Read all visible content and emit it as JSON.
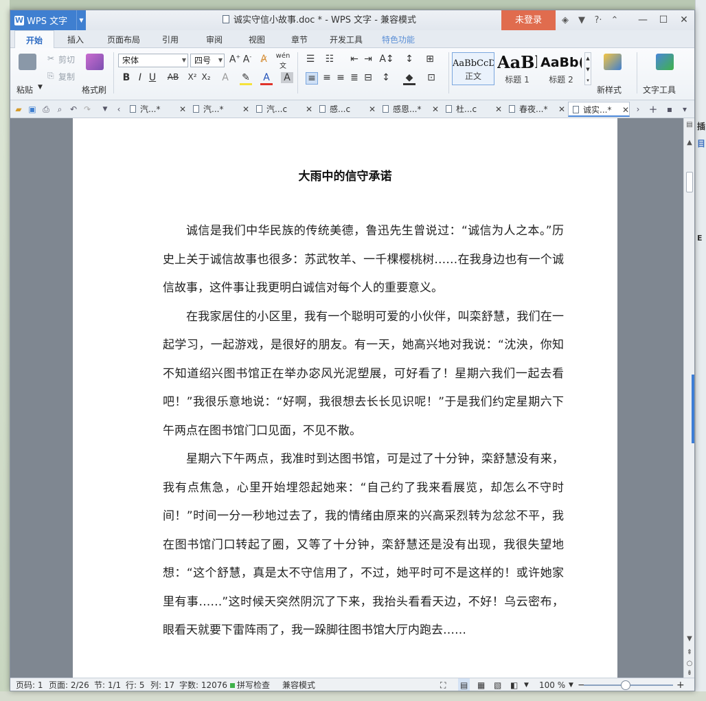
{
  "background": {
    "right_fragments": [
      "插",
      "目",
      "E"
    ]
  },
  "titlebar": {
    "app_name": "WPS 文字",
    "doc_title": "诚实守信小故事.doc * - WPS 文字 - 兼容模式",
    "login_label": "未登录"
  },
  "ribbon_tabs": [
    "开始",
    "插入",
    "页面布局",
    "引用",
    "审阅",
    "视图",
    "章节",
    "开发工具",
    "特色功能"
  ],
  "ribbon": {
    "paste": "粘贴",
    "cut": "剪切",
    "copy": "复制",
    "format_painter": "格式刷",
    "font_name": "宋体",
    "font_size": "四号",
    "styles": [
      {
        "sample": "AaBbCcD",
        "name": "正文"
      },
      {
        "sample": "AaBl",
        "name": "标题 1"
      },
      {
        "sample": "AaBb(",
        "name": "标题 2"
      }
    ],
    "new_style": "新样式",
    "text_tools": "文字工具"
  },
  "doc_tabs": [
    {
      "label": "汽...*",
      "active": false
    },
    {
      "label": "汽...*",
      "active": false
    },
    {
      "label": "汽...c",
      "active": false
    },
    {
      "label": "感...c",
      "active": false
    },
    {
      "label": "感恩...*",
      "active": false
    },
    {
      "label": "杜...c",
      "active": false
    },
    {
      "label": "春夜...*",
      "active": false
    },
    {
      "label": "诚实...*",
      "active": true
    }
  ],
  "document": {
    "heading": "大雨中的信守承诺",
    "paragraphs": [
      "诚信是我们中华民族的传统美德，鲁迅先生曾说过：“诚信为人之本。”历史上关于诚信故事也很多：苏武牧羊、一千棵樱桃树……在我身边也有一个诚信故事，这件事让我更明白诚信对每个人的重要意义。",
      "在我家居住的小区里，我有一个聪明可爱的小伙伴，叫栾舒慧，我们在一起学习，一起游戏，是很好的朋友。有一天，她高兴地对我说：“沈泱，你知不知道绍兴图书馆正在举办宓风光泥塑展，可好看了！星期六我们一起去看吧！”我很乐意地说：“好啊，我很想去长长见识呢！”于是我们约定星期六下午两点在图书馆门口见面，不见不散。",
      "星期六下午两点，我准时到达图书馆，可是过了十分钟，栾舒慧没有来，我有点焦急，心里开始埋怨起她来：“自己约了我来看展览，却怎么不守时间！”时间一分一秒地过去了，我的情绪由原来的兴高采烈转为忿忿不平，我在图书馆门口转起了圈，又等了十分钟，栾舒慧还是没有出现，我很失望地想：“这个舒慧，真是太不守信用了，不过，她平时可不是这样的！或许她家里有事……”这时候天突然阴沉了下来，我抬头看看天边，不好！乌云密布，眼看天就要下雷阵雨了，我一跺脚往图书馆大厅内跑去……"
    ]
  },
  "statusbar": {
    "page_num": "页码: 1",
    "page": "页面: 2/26",
    "section": "节: 1/1",
    "row": "行: 5",
    "col": "列: 17",
    "word_count": "字数: 12076",
    "spell_check": "拼写检查",
    "compat": "兼容模式",
    "zoom": "100 %"
  },
  "colors": {
    "accent": "#3f7fd0",
    "login": "#e06c4e",
    "doc_bg": "#7f8791"
  }
}
